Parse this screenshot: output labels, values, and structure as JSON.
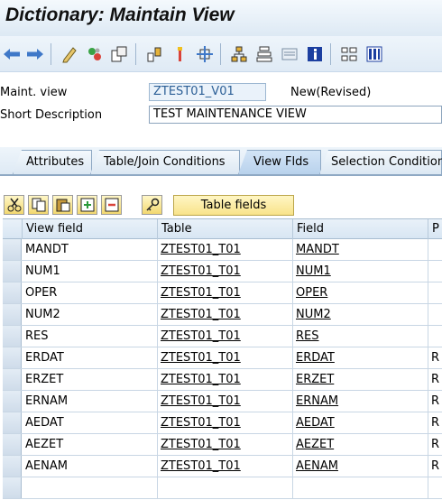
{
  "window": {
    "title": "Dictionary: Maintain View"
  },
  "toolbar": {
    "icons": [
      "back-arrow-icon",
      "forward-arrow-icon",
      "change-display-icon",
      "activate-icon",
      "other-object-icon",
      "check-icon",
      "where-used-icon",
      "navigate-icon",
      "hierarchy-icon",
      "tree-icon",
      "list-icon",
      "info-icon",
      "structure-icon",
      "columns-icon"
    ]
  },
  "form": {
    "maint_view_label": "Maint. view",
    "maint_view_value": "ZTEST01_V01",
    "maint_view_status": "New(Revised)",
    "short_desc_label": "Short Description",
    "short_desc_value": "TEST MAINTENANCE VIEW"
  },
  "tabs": [
    {
      "label": "Attributes"
    },
    {
      "label": "Table/Join Conditions"
    },
    {
      "label": "View Flds"
    },
    {
      "label": "Selection Conditions"
    }
  ],
  "table_toolbar": {
    "table_fields_label": "Table fields"
  },
  "grid": {
    "headers": {
      "view_field": "View field",
      "table": "Table",
      "field": "Field",
      "p": "P"
    },
    "rows": [
      {
        "view_field": "MANDT",
        "table": "ZTEST01_T01",
        "field": "MANDT",
        "p": ""
      },
      {
        "view_field": "NUM1",
        "table": "ZTEST01_T01",
        "field": "NUM1",
        "p": ""
      },
      {
        "view_field": "OPER",
        "table": "ZTEST01_T01",
        "field": "OPER",
        "p": ""
      },
      {
        "view_field": "NUM2",
        "table": "ZTEST01_T01",
        "field": "NUM2",
        "p": ""
      },
      {
        "view_field": "RES",
        "table": "ZTEST01_T01",
        "field": "RES",
        "p": ""
      },
      {
        "view_field": "ERDAT",
        "table": "ZTEST01_T01",
        "field": "ERDAT",
        "p": "R"
      },
      {
        "view_field": "ERZET",
        "table": "ZTEST01_T01",
        "field": "ERZET",
        "p": "R"
      },
      {
        "view_field": "ERNAM",
        "table": "ZTEST01_T01",
        "field": "ERNAM",
        "p": "R"
      },
      {
        "view_field": "AEDAT",
        "table": "ZTEST01_T01",
        "field": "AEDAT",
        "p": "R"
      },
      {
        "view_field": "AEZET",
        "table": "ZTEST01_T01",
        "field": "AEZET",
        "p": "R"
      },
      {
        "view_field": "AENAM",
        "table": "ZTEST01_T01",
        "field": "AENAM",
        "p": "R"
      },
      {
        "view_field": "",
        "table": "",
        "field": "",
        "p": ""
      }
    ]
  },
  "colors": {
    "accent": "#2c5f96",
    "button_yellow": "#f8e38a",
    "header_bg": "#dde9f4"
  }
}
